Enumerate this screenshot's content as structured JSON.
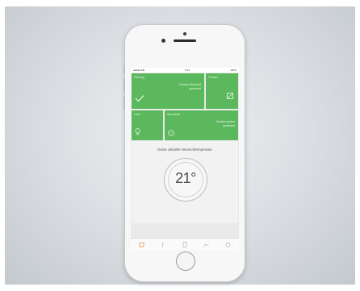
{
  "status_bar": {
    "carrier": "●●●●● DE",
    "time": "9:41",
    "battery": "100%"
  },
  "tiles": [
    {
      "label": "Heizung",
      "text_line1": "Thermo Standard",
      "text_line2": "gesteuert",
      "icon": "check-icon"
    },
    {
      "label": "Fenster",
      "text_line1": "",
      "text_line2": "",
      "icon": "window-icon"
    },
    {
      "label": "Licht",
      "text_line1": "",
      "text_line2": "",
      "icon": "bulb-icon"
    },
    {
      "label": "Steckdose",
      "text_line1": "Geräte werden",
      "text_line2": "gesteuert",
      "icon": "socket-icon"
    }
  ],
  "thermostat": {
    "title": "Deine aktuelle Wunschtemperatur",
    "value": "21°"
  },
  "tabbar": {
    "items": [
      "home-icon",
      "bulb-icon",
      "device-icon",
      "chart-icon",
      "settings-icon"
    ],
    "active_index": 0
  },
  "colors": {
    "tile_green": "#5cb85c",
    "accent_orange": "#f39c6b"
  }
}
